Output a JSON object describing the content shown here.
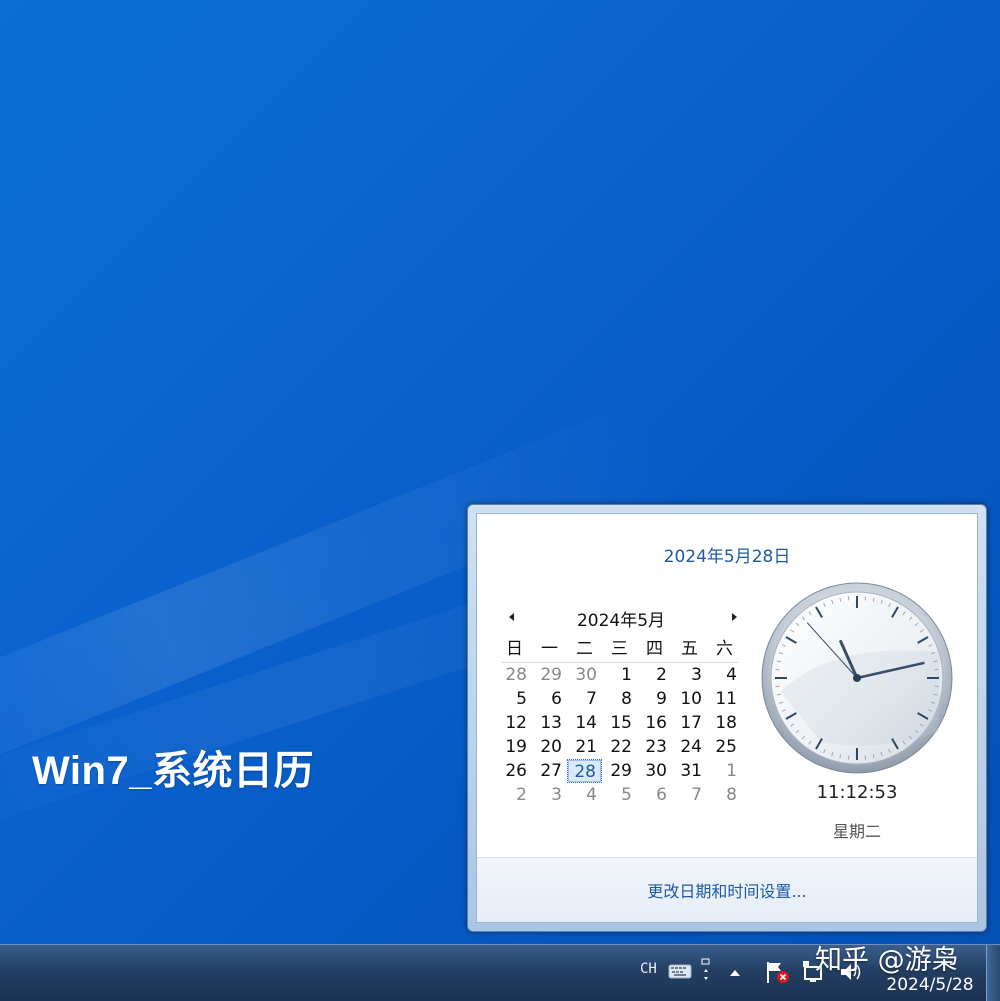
{
  "overlay": {
    "title": "Win7_系统日历"
  },
  "flyout": {
    "long_date": "2024年5月28日",
    "month_title": "2024年5月",
    "weekday_headers": [
      "日",
      "一",
      "二",
      "三",
      "四",
      "五",
      "六"
    ],
    "weeks": [
      [
        {
          "d": "28",
          "other": true
        },
        {
          "d": "29",
          "other": true
        },
        {
          "d": "30",
          "other": true
        },
        {
          "d": "1"
        },
        {
          "d": "2"
        },
        {
          "d": "3"
        },
        {
          "d": "4"
        }
      ],
      [
        {
          "d": "5"
        },
        {
          "d": "6"
        },
        {
          "d": "7"
        },
        {
          "d": "8"
        },
        {
          "d": "9"
        },
        {
          "d": "10"
        },
        {
          "d": "11"
        }
      ],
      [
        {
          "d": "12"
        },
        {
          "d": "13"
        },
        {
          "d": "14"
        },
        {
          "d": "15"
        },
        {
          "d": "16"
        },
        {
          "d": "17"
        },
        {
          "d": "18"
        }
      ],
      [
        {
          "d": "19"
        },
        {
          "d": "20"
        },
        {
          "d": "21"
        },
        {
          "d": "22"
        },
        {
          "d": "23"
        },
        {
          "d": "24"
        },
        {
          "d": "25"
        }
      ],
      [
        {
          "d": "26"
        },
        {
          "d": "27"
        },
        {
          "d": "28",
          "today": true
        },
        {
          "d": "29"
        },
        {
          "d": "30"
        },
        {
          "d": "31"
        },
        {
          "d": "1",
          "other": true
        }
      ],
      [
        {
          "d": "2",
          "other": true
        },
        {
          "d": "3",
          "other": true
        },
        {
          "d": "4",
          "other": true
        },
        {
          "d": "5",
          "other": true
        },
        {
          "d": "6",
          "other": true
        },
        {
          "d": "7",
          "other": true
        },
        {
          "d": "8",
          "other": true
        }
      ]
    ],
    "time": "11:12:53",
    "weekday": "星期二",
    "change_settings_link": "更改日期和时间设置..."
  },
  "taskbar": {
    "language": "CH",
    "date": "2024/5/28",
    "icons": [
      "keyboard-icon",
      "input-method-icon",
      "show-hidden-icons-arrow",
      "action-center-flag-icon",
      "network-icon",
      "volume-icon"
    ]
  },
  "watermark": "知乎 @游枭",
  "colors": {
    "accent": "#1e5aa0",
    "desktop": "#0b63cf"
  }
}
